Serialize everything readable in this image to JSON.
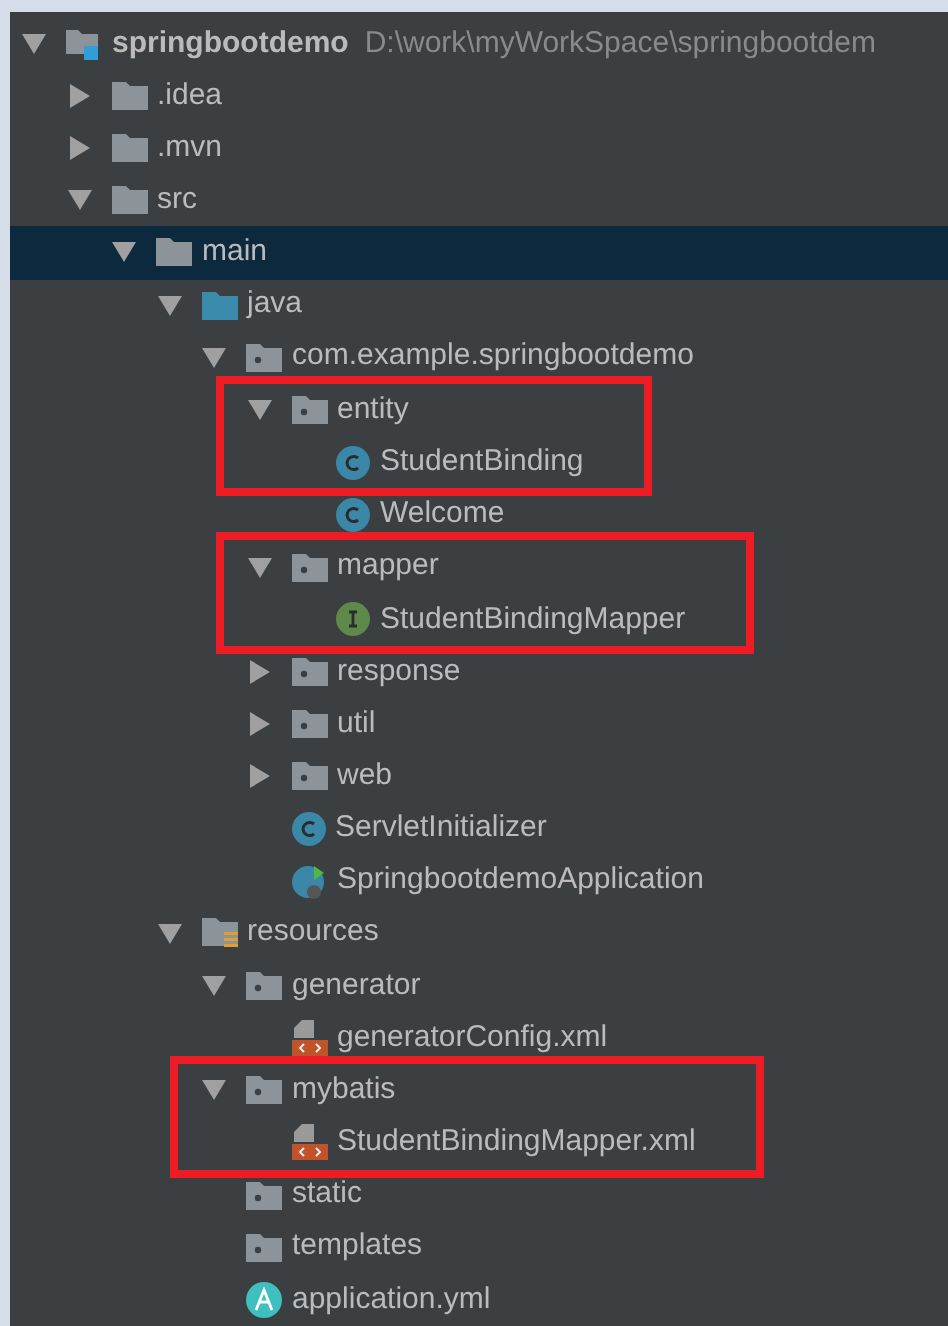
{
  "tree": [
    {
      "kind": "module",
      "label": "springbootdemo",
      "path": "D:\\work\\myWorkSpace\\springbootdem",
      "expanded": true,
      "selected": false,
      "highlighted": false,
      "children": [
        {
          "kind": "folder",
          "label": ".idea",
          "expanded": false,
          "selected": false,
          "highlighted": false
        },
        {
          "kind": "folder",
          "label": ".mvn",
          "expanded": false,
          "selected": false,
          "highlighted": false
        },
        {
          "kind": "folder",
          "label": "src",
          "expanded": true,
          "selected": false,
          "highlighted": false,
          "children": [
            {
              "kind": "folder",
              "label": "main",
              "expanded": true,
              "selected": true,
              "highlighted": false,
              "children": [
                {
                  "kind": "source",
                  "label": "java",
                  "expanded": true,
                  "selected": false,
                  "highlighted": false,
                  "children": [
                    {
                      "kind": "package",
                      "label": "com.example.springbootdemo",
                      "expanded": true,
                      "selected": false,
                      "highlighted": false,
                      "children": [
                        {
                          "kind": "package",
                          "label": "entity",
                          "expanded": true,
                          "selected": false,
                          "highlighted": true,
                          "children": [
                            {
                              "kind": "class",
                              "label": "StudentBinding",
                              "selected": false,
                              "highlighted": true
                            },
                            {
                              "kind": "class",
                              "label": "Welcome",
                              "selected": false,
                              "highlighted": false
                            }
                          ]
                        },
                        {
                          "kind": "package",
                          "label": "mapper",
                          "expanded": true,
                          "selected": false,
                          "highlighted": true,
                          "children": [
                            {
                              "kind": "interface",
                              "label": "StudentBindingMapper",
                              "selected": false,
                              "highlighted": true
                            }
                          ]
                        },
                        {
                          "kind": "package",
                          "label": "response",
                          "expanded": false,
                          "selected": false,
                          "highlighted": false
                        },
                        {
                          "kind": "package",
                          "label": "util",
                          "expanded": false,
                          "selected": false,
                          "highlighted": false
                        },
                        {
                          "kind": "package",
                          "label": "web",
                          "expanded": false,
                          "selected": false,
                          "highlighted": false
                        },
                        {
                          "kind": "class",
                          "label": "ServletInitializer",
                          "selected": false,
                          "highlighted": false
                        },
                        {
                          "kind": "app",
                          "label": "SpringbootdemoApplication",
                          "selected": false,
                          "highlighted": false
                        }
                      ]
                    }
                  ]
                },
                {
                  "kind": "resources",
                  "label": "resources",
                  "expanded": true,
                  "selected": false,
                  "highlighted": false,
                  "children": [
                    {
                      "kind": "package",
                      "label": "generator",
                      "expanded": true,
                      "selected": false,
                      "highlighted": false,
                      "children": [
                        {
                          "kind": "xml",
                          "label": "generatorConfig.xml",
                          "selected": false,
                          "highlighted": false
                        }
                      ]
                    },
                    {
                      "kind": "package",
                      "label": "mybatis",
                      "expanded": true,
                      "selected": false,
                      "highlighted": true,
                      "children": [
                        {
                          "kind": "xml",
                          "label": "StudentBindingMapper.xml",
                          "selected": false,
                          "highlighted": true
                        }
                      ]
                    },
                    {
                      "kind": "package",
                      "label": "static",
                      "selected": false,
                      "highlighted": false
                    },
                    {
                      "kind": "package",
                      "label": "templates",
                      "selected": false,
                      "highlighted": false
                    },
                    {
                      "kind": "yml",
                      "label": "application.yml",
                      "selected": false,
                      "highlighted": false
                    }
                  ]
                }
              ]
            }
          ]
        }
      ]
    }
  ]
}
